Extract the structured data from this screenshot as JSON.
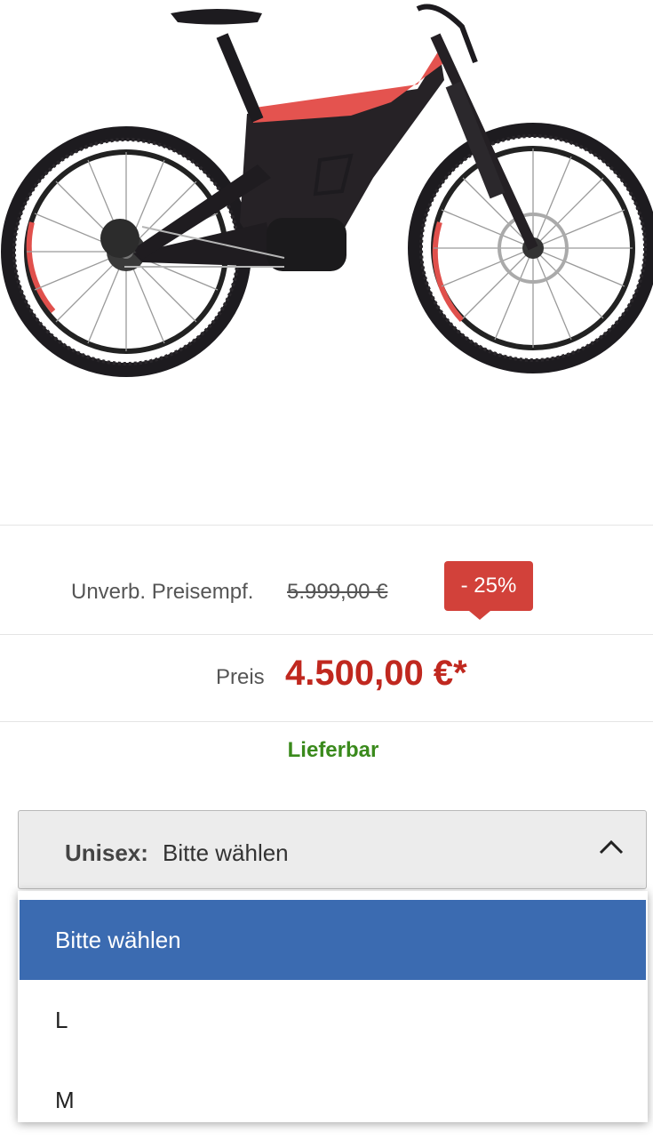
{
  "product": {
    "image_name": "e-mountainbike"
  },
  "pricing": {
    "rrp_label": "Unverb. Preisempf.",
    "rrp_value": "5.999,00 €",
    "discount_badge": "- 25%",
    "price_label": "Preis",
    "price_value": "4.500,00 €*"
  },
  "availability": {
    "status": "Lieferbar",
    "color": "#3a8a1c"
  },
  "variant_select": {
    "label": "Unisex:",
    "value": "Bitte wählen",
    "icon": "chevron-up-icon",
    "options": [
      "Bitte wählen",
      "L",
      "M"
    ],
    "selected_index": 0
  },
  "colors": {
    "price": "#c0281f",
    "discount": "#d2413a",
    "selection": "#3b6bb1"
  }
}
